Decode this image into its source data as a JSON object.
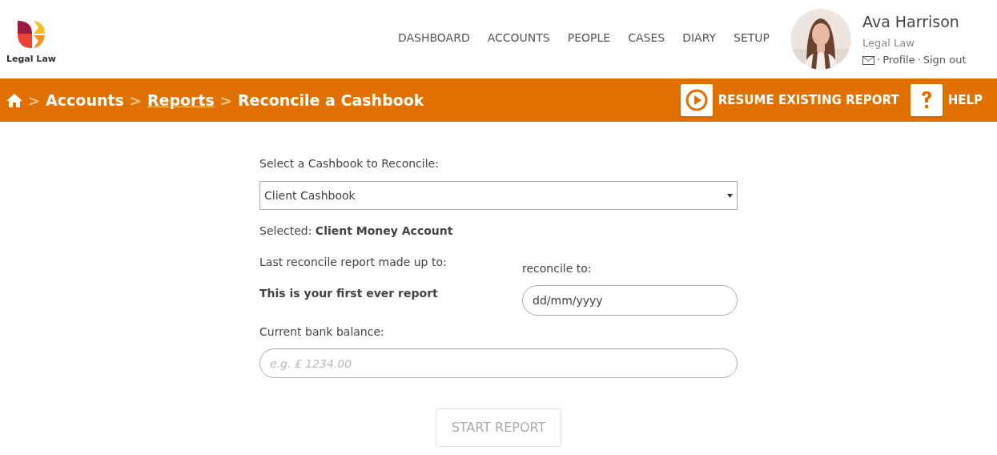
{
  "logo": {
    "name": "Legal Law"
  },
  "nav": [
    {
      "label": "DASHBOARD"
    },
    {
      "label": "ACCOUNTS"
    },
    {
      "label": "PEOPLE"
    },
    {
      "label": "CASES"
    },
    {
      "label": "DIARY"
    },
    {
      "label": "SETUP"
    }
  ],
  "user": {
    "name": "Ava Harrison",
    "company": "Legal Law",
    "separator_1": "·",
    "profile": "Profile",
    "separator_2": "·",
    "sign_out": "Sign out"
  },
  "breadcrumb": [
    {
      "label": "Accounts",
      "link": false
    },
    {
      "label": "Reports",
      "link": true
    },
    {
      "label": "Reconcile a Cashbook",
      "link": false
    }
  ],
  "breadcrumb_separator": ">",
  "actions": [
    {
      "kind": "resume",
      "label": "RESUME EXISTING REPORT"
    },
    {
      "kind": "help",
      "label": "HELP"
    }
  ],
  "form": {
    "cashbook_label": "Select a Cashbook to Reconcile:",
    "cashbook_value": "Client Cashbook",
    "selected_text": "Selected: **Client Money Account**",
    "last_label": "Last reconcile report made up to:",
    "last_value": "This is your first ever report",
    "reconcile_label": "reconcile to:",
    "reconcile_placeholder": "dd/mm/yyyy",
    "balance_label": "Current bank balance:",
    "balance_placeholder": "e.g. £ 1234.00",
    "submit": {
      "label": "START REPORT",
      "disabled": true
    }
  }
}
